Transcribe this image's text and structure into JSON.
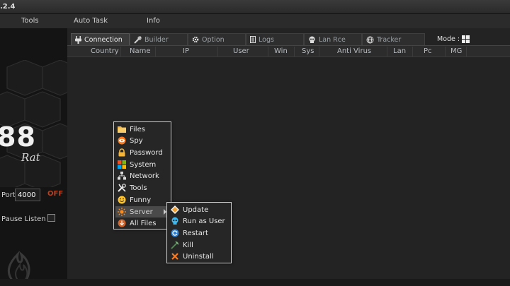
{
  "titlebar": {
    "version": ".2.4"
  },
  "menu": {
    "tools": "Tools",
    "auto_task": "Auto Task",
    "info": "Info"
  },
  "sidebar": {
    "logo_number": "88",
    "logo_text": "Rat",
    "port_label": "Port",
    "port_value": "4000",
    "status_badge": "OFF",
    "pause_label": "Pause Listen"
  },
  "tabs": {
    "connection": "Connection",
    "builder": "Builder",
    "option": "Option",
    "logs": "Logs",
    "lan_rce": "Lan Rce",
    "tracker": "Tracker"
  },
  "mode_label": "Mode :",
  "columns": {
    "country": "Country",
    "name": "Name",
    "ip": "IP",
    "user": "User",
    "win": "Win",
    "sys": "Sys",
    "antivirus": "Anti Virus",
    "lan": "Lan",
    "pc": "Pc",
    "mg": "MG"
  },
  "context_menu": {
    "items": [
      "Files",
      "Spy",
      "Password",
      "System",
      "Network",
      "Tools",
      "Funny",
      "Server",
      "All Files"
    ],
    "icons": [
      "folder-icon",
      "eye-icon",
      "lock-icon",
      "windows-icon",
      "network-icon",
      "tools-icon",
      "smiley-icon",
      "sun-icon",
      "download-icon"
    ]
  },
  "server_submenu": {
    "items": [
      "Update",
      "Run as User",
      "Restart",
      "Kill",
      "Uninstall"
    ],
    "icons": [
      "update-icon",
      "skull-icon",
      "restart-icon",
      "kill-icon",
      "close-icon"
    ]
  },
  "colors": {
    "status_off": "#b84020",
    "menu_border": "#d0d0d0",
    "highlight": "#4a4a4a",
    "orange": "#ff8a1c"
  }
}
